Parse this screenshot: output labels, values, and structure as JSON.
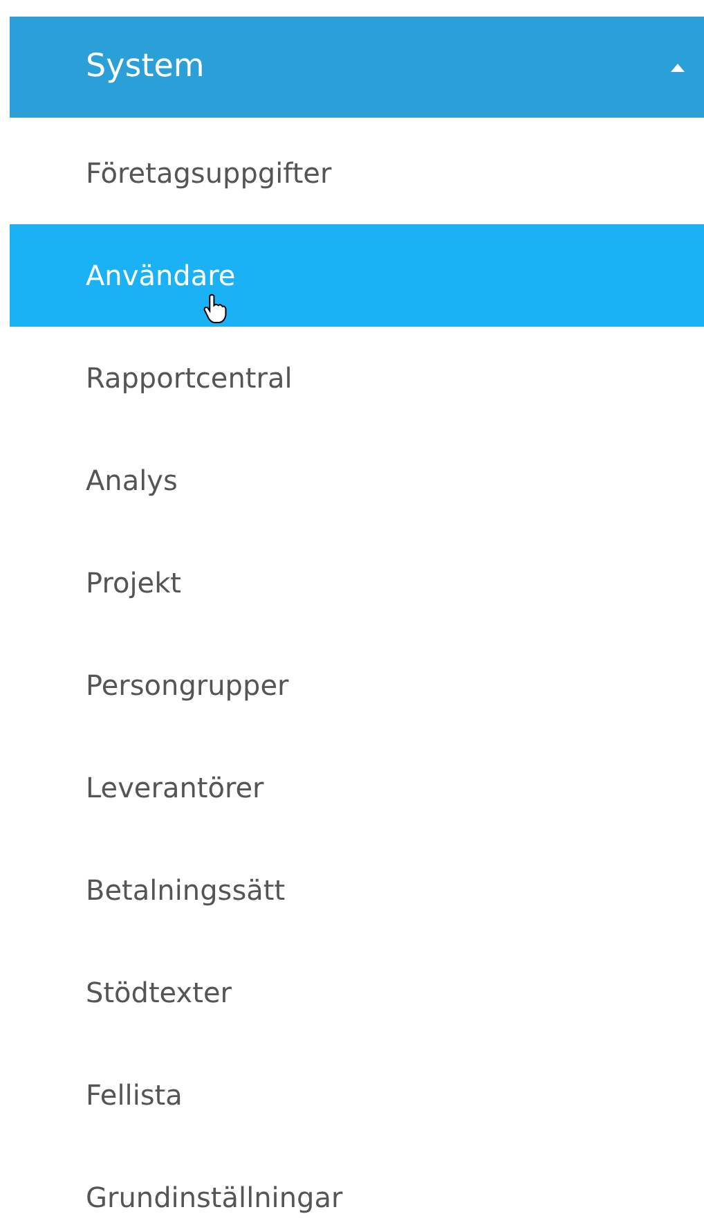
{
  "section": {
    "title": "System",
    "expanded": true
  },
  "items": [
    {
      "label": "Företagsuppgifter",
      "selected": false
    },
    {
      "label": "Användare",
      "selected": true
    },
    {
      "label": "Rapportcentral",
      "selected": false
    },
    {
      "label": "Analys",
      "selected": false
    },
    {
      "label": "Projekt",
      "selected": false
    },
    {
      "label": "Persongrupper",
      "selected": false
    },
    {
      "label": "Leverantörer",
      "selected": false
    },
    {
      "label": "Betalningssätt",
      "selected": false
    },
    {
      "label": "Stödtexter",
      "selected": false
    },
    {
      "label": "Fellista",
      "selected": false
    },
    {
      "label": "Grundinställningar",
      "selected": false
    }
  ]
}
